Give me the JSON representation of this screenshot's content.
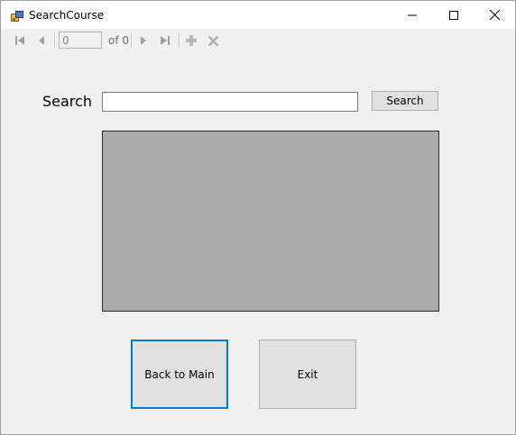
{
  "window": {
    "title": "SearchCourse"
  },
  "title_controls": {
    "minimize_icon": "minimize-icon",
    "maximize_icon": "maximize-icon",
    "close_icon": "close-icon"
  },
  "navigator": {
    "position_value": "0",
    "count_label": "of 0",
    "icons": [
      "move-first-icon",
      "move-previous-icon",
      "move-next-icon",
      "move-last-icon",
      "add-new-icon",
      "delete-icon"
    ]
  },
  "search": {
    "label": "Search",
    "input_value": "",
    "button_label": "Search"
  },
  "buttons": {
    "back_label": "Back to Main",
    "exit_label": "Exit"
  },
  "colors": {
    "accent": "#0078d7",
    "grid_background": "#ababab",
    "button_face": "#e1e1e1"
  }
}
